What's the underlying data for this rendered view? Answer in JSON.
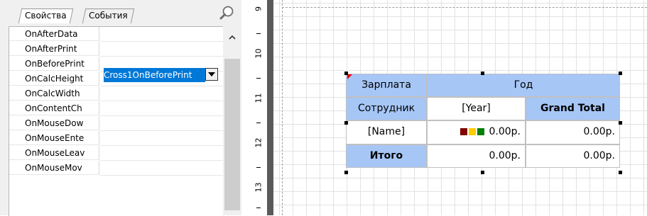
{
  "inspector": {
    "tabs": [
      {
        "label": "Свойства",
        "active": true
      },
      {
        "label": "События",
        "active": false
      }
    ],
    "search_icon": "magnifier-icon",
    "events": [
      {
        "name": "OnAfterData"
      },
      {
        "name": "OnAfterPrint"
      },
      {
        "name": "OnBeforePrint",
        "value": "Cross1OnBeforePrint",
        "selected": true
      },
      {
        "name": "OnCalcHeight"
      },
      {
        "name": "OnCalcWidth"
      },
      {
        "name": "OnContentCh"
      },
      {
        "name": "OnMouseDow"
      },
      {
        "name": "OnMouseEnte"
      },
      {
        "name": "OnMouseLeav"
      },
      {
        "name": "OnMouseMov"
      }
    ],
    "edit_value": "Cross1OnBeforePrint"
  },
  "ruler": {
    "labels": [
      "9",
      "10",
      "11",
      "12",
      "13"
    ]
  },
  "crosstab": {
    "corner": "Зарплата",
    "column_header": "Год",
    "row_header": "Сотрудник",
    "column_field": "[Year]",
    "grand_total": "Grand Total",
    "row_field": "[Name]",
    "value_cell": "0.00р.",
    "row_total_value": "0.00р.",
    "total_label": "Итого",
    "total_value": "0.00р.",
    "grand_value": "0.00р.",
    "indicator_colors": [
      "#800000",
      "#ffcc00",
      "#008000"
    ],
    "header_color": "#a6c6f6"
  }
}
